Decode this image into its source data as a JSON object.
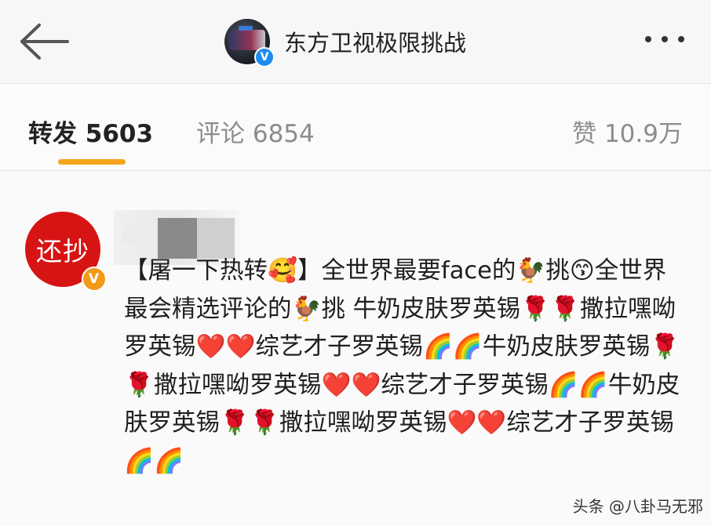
{
  "header": {
    "account_name": "东方卫视极限挑战",
    "verified_mark": "V"
  },
  "tabs": {
    "repost": "转发 5603",
    "comment": "评论 6854",
    "like": "赞 10.9万"
  },
  "post": {
    "avatar_text": "还抄",
    "avatar_badge": "V",
    "content": "【屠一下热转🥰】全世界最要face的🐓挑😙全世界最会精选评论的🐓挑 牛奶皮肤罗英锡🌹🌹撒拉嘿呦罗英锡❤️❤️综艺才子罗英锡🌈🌈牛奶皮肤罗英锡🌹🌹撒拉嘿呦罗英锡❤️❤️综艺才子罗英锡🌈🌈牛奶皮肤罗英锡🌹🌹撒拉嘿呦罗英锡❤️❤️综艺才子罗英锡🌈🌈"
  },
  "watermark": "头条 @八卦马无邪",
  "colors": {
    "tab_underline": "#f4a51c",
    "avatar_bg": "#d71414",
    "verified_blue": "#1d8cf0",
    "verified_orange": "#f39a19"
  }
}
